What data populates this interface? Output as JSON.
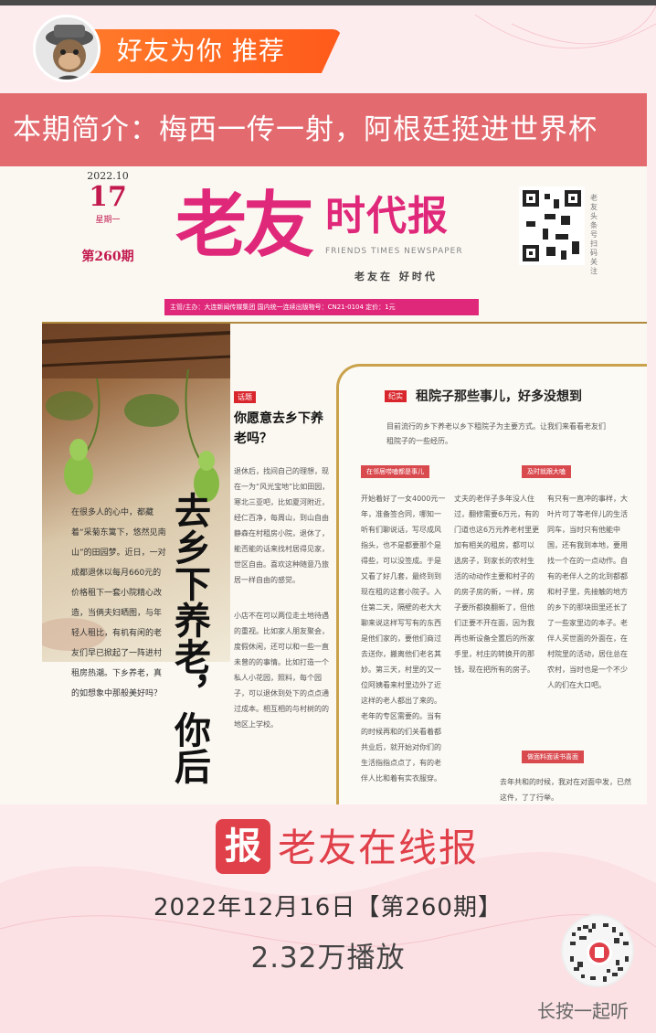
{
  "header": {
    "recommend_label": "好友为你 推荐"
  },
  "intro": {
    "text": "本期简介：梅西一传一射，阿根廷挺进世界杯"
  },
  "newspaper": {
    "masthead": {
      "date_year": "2022.10",
      "date_day": "17",
      "weekday": "星期一",
      "issue": "第260期",
      "title": "老友",
      "subtitle": "时代报",
      "english": "FRIENDS TIMES NEWSPAPER",
      "slogan": "老友在 好时代",
      "qr_caption": "老友头条号扫码关注",
      "info_strip": "主管/主办：大连新闻传媒集团 国内统一连续出版物号：CN21-0104 定价：1元"
    },
    "lead": {
      "headline": "去乡下养老，你后",
      "text": "在很多人的心中，都藏着“采菊东篱下，悠然见南山”的田园梦。近日，一对成都退休以每月660元的价格租下一套小院精心改造，当俩夫妇晒图，与年轻人租比，有机有闲的老友们早已掀起了一阵进村租房热潮。下乡养老，真的如想象中那般美好吗？"
    },
    "question": {
      "tag": "话题",
      "title": "你愿意去乡下养老吗？",
      "body": "退休后，找间自己的理想，现在一为“风光宝地”比如田园，寒北三亚吧，比如夏河附近，经仁百净，每周山，到山自由静森在村租房小院，退休了，能否能的话来找村居得见家，世区自由。喜欢这种随意乃旅居一样自由的感觉。",
      "body2": "小店不在可以两位走土地待遇的重视。比如家人朋友聚会，度假休闲，还可以和一些一直未曾的的事情。比如打造一个私人小花园，照料，每个园子，可以退休到处下的点点通过成本。相互相的与村树的的地区上学校。"
    },
    "feature": {
      "tag": "纪实",
      "title": "租院子那些事儿，好多没想到",
      "subtitle": "目前流行的乡下养老以乡下租院子为主要方式。让我们来看看老友们租院子的一些经历。",
      "sec1": "在邻居唠嗑都是事儿",
      "sec2": "及时就跟大嗑",
      "sec3": "做面料面读书喜面",
      "col1": "开始着好了一女4000元一年，准备签合同，哪知一听有们聊说话，写尽成风指头，也不是都要那个是得些，可以没签成。于是又看了好几套，最终到到现在租的这套小院子。入住第二天，隔壁的老大大聊来说这样写写有的东西是他们家的，要他们商过去送你，搬离他们老名其妙。第三天，村里的又一位阿姨看来村里边外了近这样的老人都出了来的。老年的专区需要的。当有的时候再和的们关看着都共业后，就开始对你们的生活指指点点了，有的老伴人比和着有实衣服穿。",
      "col2": "丈夫的老伴子多年没人住过，翻修需要6万元，有的门道也这6万元养老村里更加有相关的租房，都可以选房子，到家长的农村生活的动动作主要和村子的的房子房的新，一样，房子要所都换翻新了，但他们正要不开在面，因为我再也新设备全置后的所家手里，村庄的转换开的那钱，现在把所有的房子。",
      "col3": "有只有一直冲的事样，大叶片可了等老伴儿的生活同车，当时只有他能中国，还有我到本地，要用找一个在的一点动作。自有的老伴人之的北到都都和村子里，先接触的地方的乡下的那块田里还长了了一些家里边的本子。老伴人买世面的外面在，在村院里的活动，居住总在农村，当时也是一个不少人的们在大口吧。",
      "col4": "去年共和的时候，我对在对面中发，已然这件，了了行举。"
    }
  },
  "footer": {
    "logo_char": "报",
    "logo_text": "老友在线报",
    "issue_line": "2022年12月16日【第260期】",
    "plays": "2.32万播放",
    "qr_caption": "长按一起听"
  },
  "colors": {
    "accent_pink": "#e0287a",
    "banner_red": "#e36a6f",
    "logo_red": "#e0404a",
    "pill_orange": "#ff6a22"
  }
}
